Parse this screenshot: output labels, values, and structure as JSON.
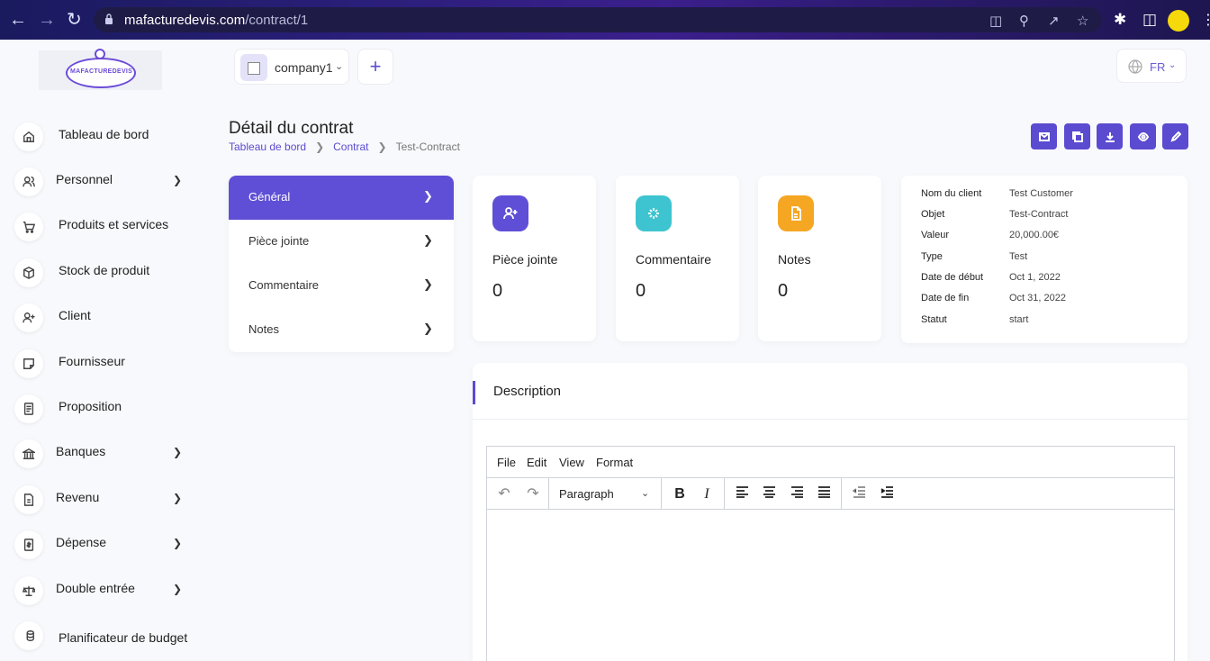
{
  "browser": {
    "url_domain": "mafacturedevis.com",
    "url_path": "/contract/1"
  },
  "logo": {
    "text": "MAFACTUREDEVIS"
  },
  "header": {
    "company": "company1",
    "language": "FR"
  },
  "sidebar": {
    "items": [
      {
        "label": "Tableau de bord",
        "icon": "home-icon",
        "has_chevron": false
      },
      {
        "label": "Personnel",
        "icon": "users-icon",
        "has_chevron": true
      },
      {
        "label": "Produits et services",
        "icon": "cart-icon",
        "has_chevron": false
      },
      {
        "label": "Stock de produit",
        "icon": "box-icon",
        "has_chevron": false
      },
      {
        "label": "Client",
        "icon": "user-plus-icon",
        "has_chevron": false
      },
      {
        "label": "Fournisseur",
        "icon": "note-icon",
        "has_chevron": false
      },
      {
        "label": "Proposition",
        "icon": "file-text-icon",
        "has_chevron": false
      },
      {
        "label": "Banques",
        "icon": "bank-icon",
        "has_chevron": true
      },
      {
        "label": "Revenu",
        "icon": "file-invoice-icon",
        "has_chevron": true
      },
      {
        "label": "Dépense",
        "icon": "receipt-icon",
        "has_chevron": true
      },
      {
        "label": "Double entrée",
        "icon": "scale-icon",
        "has_chevron": true
      },
      {
        "label": "Planificateur de budget",
        "icon": "coins-icon",
        "has_chevron": false
      }
    ]
  },
  "page": {
    "title": "Détail du contrat",
    "breadcrumb": [
      "Tableau de bord",
      "Contrat",
      "Test-Contract"
    ]
  },
  "tabs": [
    {
      "label": "Général",
      "active": true
    },
    {
      "label": "Pièce jointe",
      "active": false
    },
    {
      "label": "Commentaire",
      "active": false
    },
    {
      "label": "Notes",
      "active": false
    }
  ],
  "stats": [
    {
      "label": "Pièce jointe",
      "value": "0",
      "color": "#5f4fd6",
      "icon": "user-plus-icon"
    },
    {
      "label": "Commentaire",
      "value": "0",
      "color": "#3ec4d0",
      "icon": "loader-icon"
    },
    {
      "label": "Notes",
      "value": "0",
      "color": "#f5a623",
      "icon": "file-icon"
    }
  ],
  "info": [
    {
      "key": "Nom du client",
      "value": "Test Customer"
    },
    {
      "key": "Objet",
      "value": "Test-Contract"
    },
    {
      "key": "Valeur",
      "value": "20,000.00€"
    },
    {
      "key": "Type",
      "value": "Test"
    },
    {
      "key": "Date de début",
      "value": "Oct 1, 2022"
    },
    {
      "key": "Date de fin",
      "value": "Oct 31, 2022"
    },
    {
      "key": "Statut",
      "value": "start"
    }
  ],
  "description": {
    "title": "Description",
    "menu": [
      "File",
      "Edit",
      "View",
      "Format"
    ],
    "block_format": "Paragraph"
  },
  "colors": {
    "primary": "#5b4bd0"
  }
}
